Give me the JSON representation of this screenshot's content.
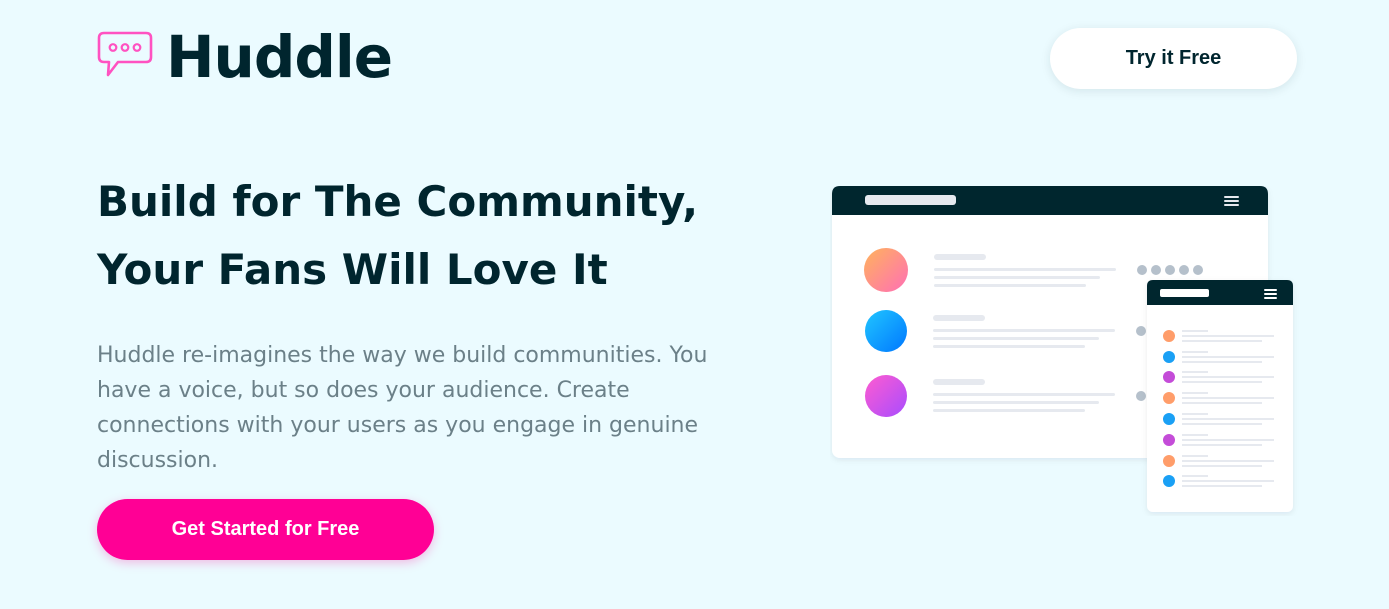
{
  "brand": {
    "name": "Huddle",
    "logo_icon": "speech-bubble-icon",
    "logo_color": "#ff52c1"
  },
  "header": {
    "try_free_label": "Try it Free"
  },
  "hero": {
    "headline_line1": "Build for The Community,",
    "headline_line2": "Your Fans Will Love It",
    "description": "Huddle re-imagines the way we build communities. You have a voice, but so does your audience. Create connections with your users as you engage in genuine discussion.",
    "cta_label": "Get Started for Free"
  },
  "illustration": {
    "menu_icon": "hamburger-icon",
    "desktop_avatar_gradients": [
      [
        "#ffb35c",
        "#ff6fb5"
      ],
      [
        "#21c6ff",
        "#0077ff"
      ],
      [
        "#ff5cd0",
        "#a84cff"
      ]
    ],
    "mobile_avatar_colors": [
      "#ff9d6a",
      "#1aa0f5",
      "#c44cd8",
      "#ff9d6a",
      "#1aa0f5",
      "#c44cd8",
      "#ff9d6a",
      "#1aa0f5"
    ]
  },
  "colors": {
    "background": "#ebfbff",
    "dark": "#00252e",
    "accent": "#ff0095",
    "muted_text": "#6b8088"
  }
}
